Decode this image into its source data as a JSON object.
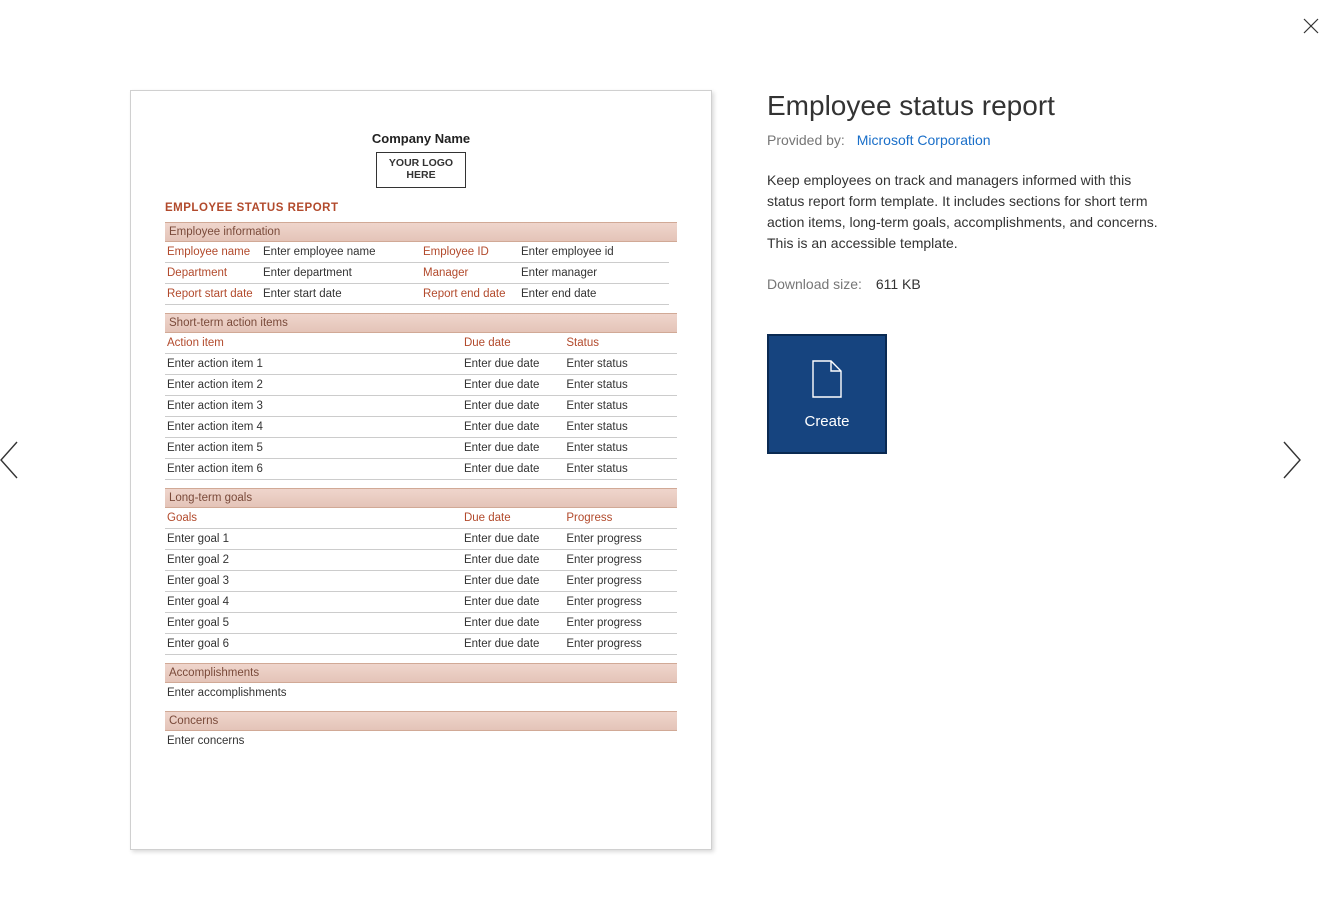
{
  "close_label": "Close",
  "prev_label": "Previous",
  "next_label": "Next",
  "preview": {
    "company_header": "Company Name",
    "logo_text": "YOUR LOGO HERE",
    "report_title": "EMPLOYEE STATUS REPORT",
    "sections": {
      "emp_info": {
        "header": "Employee information",
        "employee_name_lbl": "Employee name",
        "employee_name_val": "Enter employee name",
        "employee_id_lbl": "Employee ID",
        "employee_id_val": "Enter employee id",
        "department_lbl": "Department",
        "department_val": "Enter department",
        "manager_lbl": "Manager",
        "manager_val": "Enter manager",
        "start_lbl": "Report start date",
        "start_val": "Enter start date",
        "end_lbl": "Report end date",
        "end_val": "Enter end date"
      },
      "short_term": {
        "header": "Short-term action items",
        "col_action": "Action item",
        "col_due": "Due date",
        "col_status": "Status",
        "rows": [
          {
            "a": "Enter action item 1",
            "b": "Enter due date",
            "c": "Enter status"
          },
          {
            "a": "Enter action item 2",
            "b": "Enter due date",
            "c": "Enter status"
          },
          {
            "a": "Enter action item 3",
            "b": "Enter due date",
            "c": "Enter status"
          },
          {
            "a": "Enter action item 4",
            "b": "Enter due date",
            "c": "Enter status"
          },
          {
            "a": "Enter action item 5",
            "b": "Enter due date",
            "c": "Enter status"
          },
          {
            "a": "Enter action item 6",
            "b": "Enter due date",
            "c": "Enter status"
          }
        ]
      },
      "long_term": {
        "header": "Long-term goals",
        "col_goals": "Goals",
        "col_due": "Due date",
        "col_progress": "Progress",
        "rows": [
          {
            "a": "Enter goal 1",
            "b": "Enter due date",
            "c": "Enter progress"
          },
          {
            "a": "Enter goal 2",
            "b": "Enter due date",
            "c": "Enter progress"
          },
          {
            "a": "Enter goal 3",
            "b": "Enter due date",
            "c": "Enter progress"
          },
          {
            "a": "Enter goal 4",
            "b": "Enter due date",
            "c": "Enter progress"
          },
          {
            "a": "Enter goal 5",
            "b": "Enter due date",
            "c": "Enter progress"
          },
          {
            "a": "Enter goal 6",
            "b": "Enter due date",
            "c": "Enter progress"
          }
        ]
      },
      "accomplishments": {
        "header": "Accomplishments",
        "val": "Enter accomplishments"
      },
      "concerns": {
        "header": "Concerns",
        "val": "Enter concerns"
      }
    }
  },
  "info": {
    "title": "Employee status report",
    "provided_by_lbl": "Provided by:",
    "provider": "Microsoft Corporation",
    "description": "Keep employees on track and managers informed with this status report form template. It includes sections for short term action items, long-term goals, accomplishments, and concerns. This is an accessible template.",
    "download_lbl": "Download size:",
    "download_val": "611 KB",
    "create_label": "Create"
  }
}
